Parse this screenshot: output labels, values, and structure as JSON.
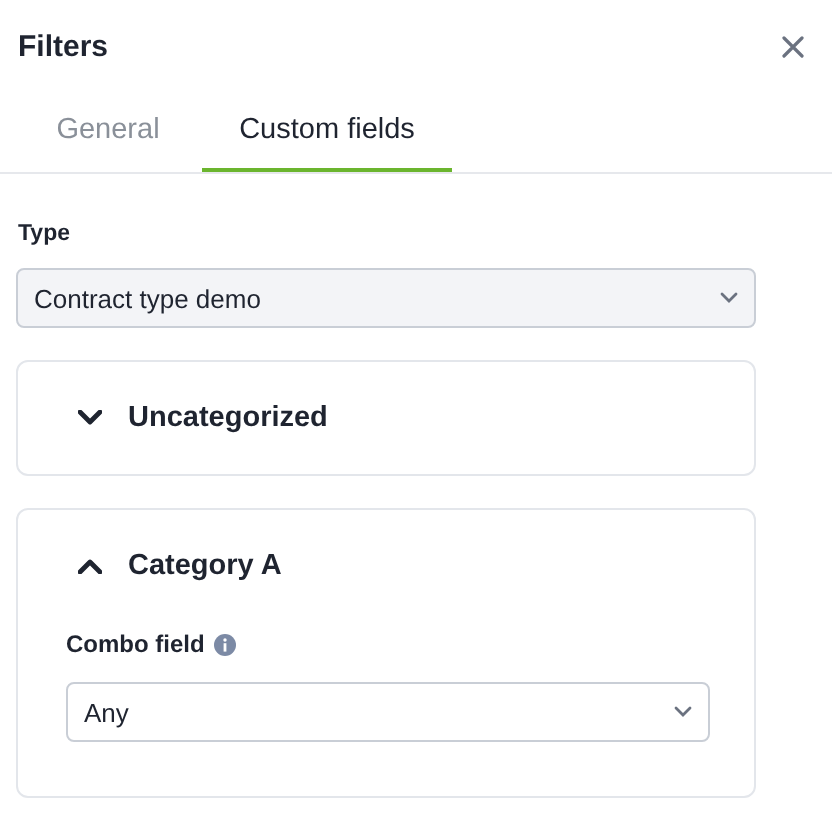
{
  "panel": {
    "title": "Filters"
  },
  "tabs": [
    {
      "label": "General",
      "selected": false
    },
    {
      "label": "Custom fields",
      "selected": true
    }
  ],
  "type_field": {
    "label": "Type",
    "value": "Contract type demo"
  },
  "categories": [
    {
      "name": "Uncategorized",
      "expanded": false
    },
    {
      "name": "Category A",
      "expanded": true,
      "fields": [
        {
          "label": "Combo field",
          "value": "Any"
        }
      ]
    }
  ]
}
